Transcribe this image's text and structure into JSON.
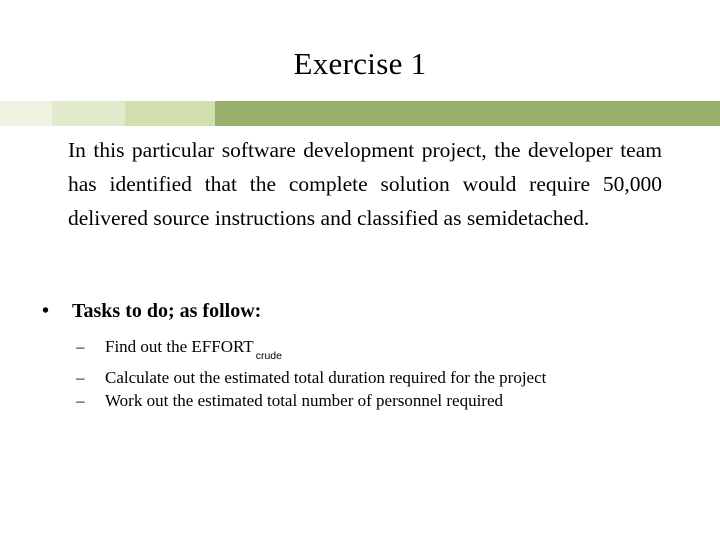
{
  "slide": {
    "title": "Exercise 1",
    "paragraph": "In this particular software development project, the developer team has identified that the complete solution would require 50,000 delivered source instructions and classified as semidetached.",
    "bullets": [
      {
        "marker": "•",
        "text": "Tasks to do; as follow:",
        "subbullets": [
          {
            "marker": "–",
            "text": "Find out the EFFORT",
            "subscript": "crude"
          },
          {
            "marker": "–",
            "text": "Calculate out the estimated total duration required for the project",
            "subscript": ""
          },
          {
            "marker": "–",
            "text": "Work out the estimated total number of personnel required",
            "subscript": ""
          }
        ]
      }
    ],
    "decor_bar": {
      "segment_1_color": "#eef3e1",
      "segment_2_color": "#e2eacd",
      "segment_3_color": "#d2e0b0",
      "segment_4_color": "#97af6b"
    },
    "background_color": "#ffffff",
    "text_color": "#000000"
  }
}
